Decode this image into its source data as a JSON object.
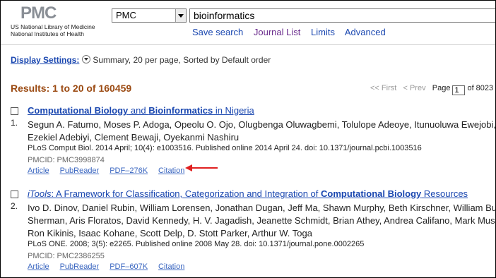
{
  "header": {
    "logo_mark": "PMC",
    "logo_line1": "US National Library of Medicine",
    "logo_line2": "National Institutes of Health",
    "db_selected": "PMC",
    "search_value": "bioinformatics",
    "links": [
      "Save search",
      "Journal List",
      "Limits",
      "Advanced"
    ]
  },
  "display": {
    "settings_label": "Display Settings:",
    "summary": "Summary, 20 per page, Sorted by Default order"
  },
  "results": {
    "count_text": "Results: 1 to 20 of 160459"
  },
  "pager": {
    "first": "<< First",
    "prev": "< Prev",
    "page_label": "Page",
    "page_value": "1",
    "of_text": "of 8023"
  },
  "items": [
    {
      "num": "1.",
      "title_parts": [
        "Computational Biology",
        " and ",
        "Bioinformatics",
        " in Nigeria"
      ],
      "authors": [
        "Segun A. Fatumo, Moses P. Adoga, Opeolu O. Ojo, Olugbenga Oluwagbemi, Tolulope Adeoye, Itunuoluwa Ewejobi, Ma",
        "Ezekiel Adebiyi, Clement Bewaji, Oyekanmi Nashiru"
      ],
      "citation": "PLoS Comput Biol. 2014 April; 10(4): e1003516. Published online 2014 April 24. doi: 10.1371/journal.pcbi.1003516",
      "pmcid": "PMCID: PMC3998874",
      "links": [
        "Article",
        "PubReader",
        "PDF–276K",
        "Citation"
      ]
    },
    {
      "num": "2.",
      "title_parts": [
        "iTools",
        ": A Framework for Classification, Categorization and Integration of ",
        "Computational Biology",
        " Resources"
      ],
      "authors": [
        "Ivo D. Dinov, Daniel Rubin, William Lorensen, Jonathan Dugan, Jeff Ma, Shawn Murphy, Beth Kirschner, William Bug, N",
        "Sherman, Aris Floratos, David Kennedy, H. V. Jagadish, Jeanette Schmidt, Brian Athey, Andrea Califano, Mark Musen,",
        "Ron Kikinis, Isaac Kohane, Scott Delp, D. Stott Parker, Arthur W. Toga"
      ],
      "citation": "PLoS ONE. 2008; 3(5): e2265. Published online 2008 May 28. doi: 10.1371/journal.pone.0002265",
      "pmcid": "PMCID: PMC2386255",
      "links": [
        "Article",
        "PubReader",
        "PDF–607K",
        "Citation"
      ]
    }
  ],
  "annotation": {
    "arrow_color": "#e02020"
  }
}
